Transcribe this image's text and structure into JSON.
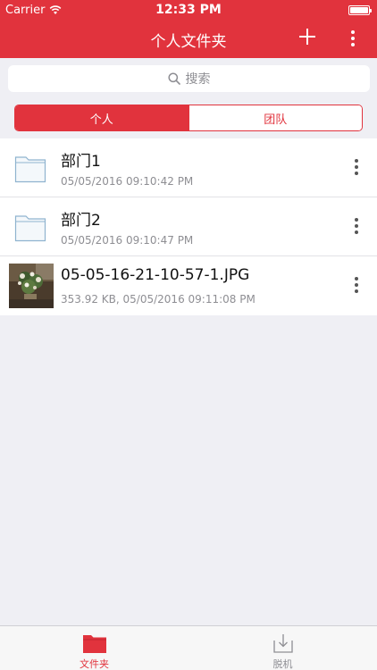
{
  "status_bar": {
    "carrier": "Carrier",
    "time": "12:33 PM"
  },
  "nav": {
    "title": "个人文件夹"
  },
  "search": {
    "placeholder": "搜索"
  },
  "segments": {
    "personal": "个人",
    "team": "团队",
    "selected": "个人"
  },
  "files": [
    {
      "name": "部门1",
      "meta": "05/05/2016 09:10:42 PM",
      "icon": "folder-icon"
    },
    {
      "name": "部门2",
      "meta": "05/05/2016 09:10:47 PM",
      "icon": "folder-icon"
    },
    {
      "name": "05-05-16-21-10-57-1.JPG",
      "meta": "353.92 KB, 05/05/2016 09:11:08 PM",
      "icon": "photo-thumbnail"
    }
  ],
  "tabs": {
    "folders": "文件夹",
    "offline": "脱机",
    "selected": "文件夹"
  },
  "colors": {
    "accent": "#e1333d",
    "background": "#efeff4",
    "meta_text": "#8e8e93"
  }
}
